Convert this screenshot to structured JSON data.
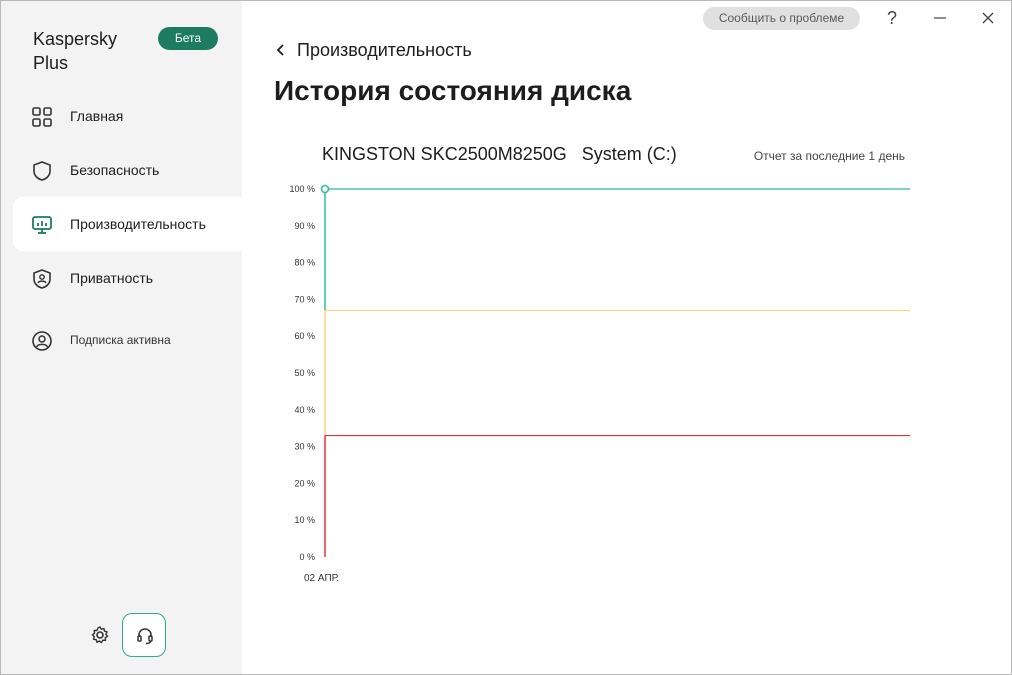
{
  "sidebar": {
    "brand": "Kaspersky Plus",
    "badge": "Бета",
    "items": [
      {
        "label": "Главная",
        "icon": "grid-icon"
      },
      {
        "label": "Безопасность",
        "icon": "shield-icon"
      },
      {
        "label": "Производительность",
        "icon": "monitor-icon"
      },
      {
        "label": "Приватность",
        "icon": "privacy-shield-icon"
      },
      {
        "label": "Подписка активна",
        "icon": "user-icon"
      }
    ],
    "active_index": 2
  },
  "titlebar": {
    "report_label": "Сообщить о проблеме",
    "help": "?",
    "minimize": "–",
    "close": "✕"
  },
  "header": {
    "back_label": "Производительность",
    "title": "История состояния диска"
  },
  "disk": {
    "name": "KINGSTON SKC2500M8250G   System (C:)",
    "period": "Отчет за последние 1 день"
  },
  "colors": {
    "accent": "#1d7b62",
    "good": "#2bbf9a",
    "warning": "#ffd37a",
    "critical": "#e4323c"
  },
  "chart_data": {
    "type": "line",
    "title": "",
    "xlabel": "",
    "ylabel": "",
    "ylim": [
      0,
      100
    ],
    "y_ticks": [
      "0 %",
      "10 %",
      "20 %",
      "30 %",
      "40 %",
      "50 %",
      "60 %",
      "70 %",
      "80 %",
      "90 %",
      "100 %"
    ],
    "x_ticks": [
      "02 АПР."
    ],
    "thresholds": [
      {
        "level": "good",
        "range": [
          67,
          100
        ]
      },
      {
        "level": "warning",
        "range": [
          33,
          67
        ]
      },
      {
        "level": "critical",
        "range": [
          0,
          33
        ]
      }
    ],
    "series": [
      {
        "x": [
          "02 АПР."
        ],
        "values": [
          100
        ]
      }
    ],
    "grid": false
  }
}
